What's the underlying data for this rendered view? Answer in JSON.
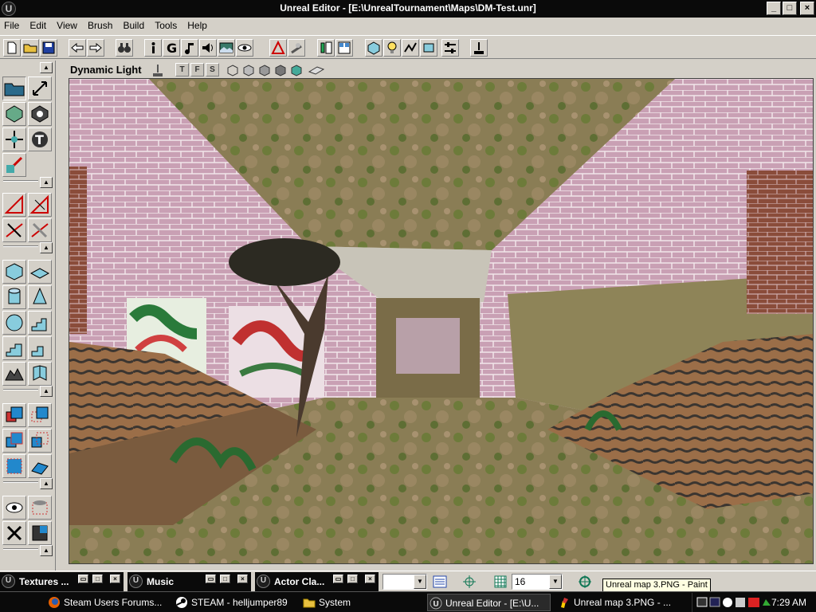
{
  "window": {
    "app_icon": "unreal-logo-icon",
    "title": "Unreal Editor - [E:\\UnrealTournament\\Maps\\DM-Test.unr]"
  },
  "menu": [
    "File",
    "Edit",
    "View",
    "Brush",
    "Build",
    "Tools",
    "Help"
  ],
  "viewport": {
    "mode_label": "Dynamic Light",
    "buttons": [
      "T",
      "F",
      "S"
    ]
  },
  "bottom_windows": [
    {
      "label": "Textures ..."
    },
    {
      "label": "Music"
    },
    {
      "label": "Actor Cla..."
    }
  ],
  "grid": {
    "value": "16"
  },
  "tooltip": "Unreal map 3.PNG - Paint",
  "taskbar": {
    "items": [
      {
        "label": "Steam Users Forums...",
        "icon": "firefox-icon"
      },
      {
        "label": "STEAM - helljumper89",
        "icon": "steam-icon"
      },
      {
        "label": "System",
        "icon": "folder-icon"
      },
      {
        "label": "Unreal Editor - [E:\\U...",
        "icon": "unreal-logo-icon"
      },
      {
        "label": "Unreal map 3.PNG - ...",
        "icon": "paint-icon"
      }
    ],
    "clock": "7:29 AM"
  }
}
